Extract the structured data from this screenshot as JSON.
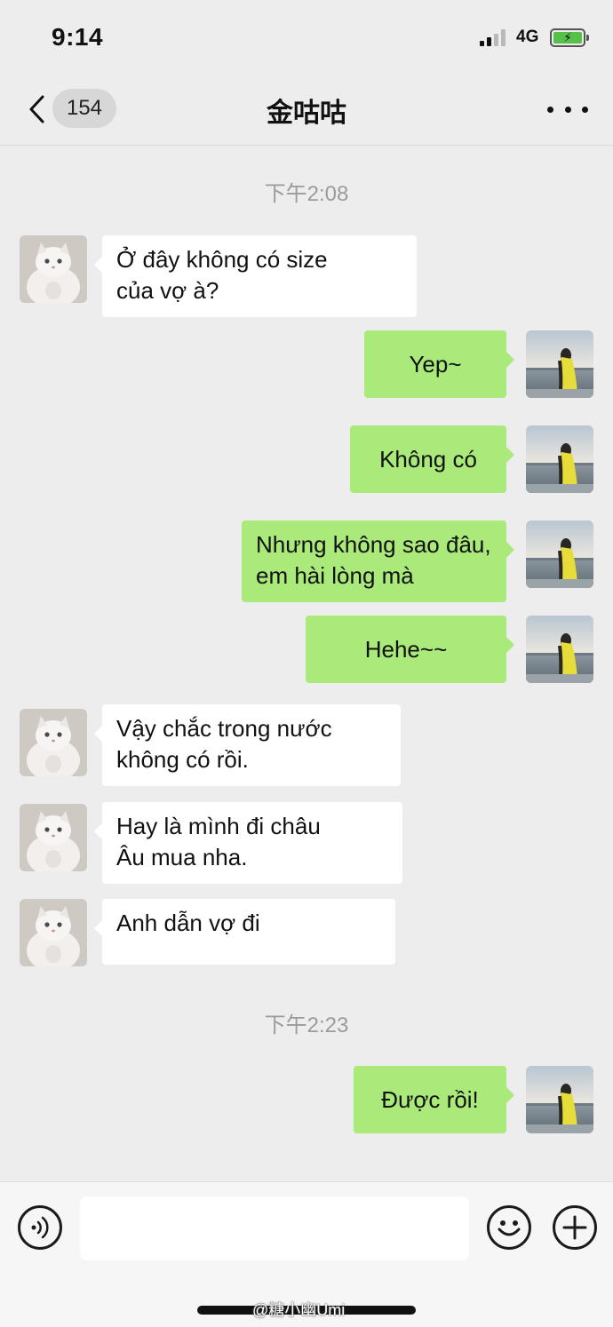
{
  "status_bar": {
    "time": "9:14",
    "network": "4G",
    "battery_charging": true
  },
  "nav": {
    "unread_count": "154",
    "title": "金咕咕"
  },
  "messages": [
    {
      "type": "time",
      "text": "下午2:08"
    },
    {
      "type": "in",
      "text": "Ở đây không có size\ncủa vợ à?",
      "avatar": "cat-avatar"
    },
    {
      "type": "out",
      "text": "Yep~",
      "avatar": "girl-avatar"
    },
    {
      "type": "out",
      "text": "Không có",
      "avatar": "girl-avatar"
    },
    {
      "type": "out",
      "text": "Nhưng không sao đâu,\nem hài lòng mà",
      "avatar": "girl-avatar"
    },
    {
      "type": "out",
      "text": "Hehe~~",
      "avatar": "girl-avatar"
    },
    {
      "type": "in",
      "text": "Vậy chắc trong nước\nkhông có rồi.",
      "avatar": "cat-avatar"
    },
    {
      "type": "in",
      "text": "Hay là mình đi châu\nÂu mua nha.",
      "avatar": "cat-avatar"
    },
    {
      "type": "in",
      "text": "Anh dẫn vợ đi",
      "avatar": "cat-avatar"
    },
    {
      "type": "time",
      "text": "下午2:23"
    },
    {
      "type": "out",
      "text": "Được rồi!",
      "avatar": "girl-avatar"
    }
  ],
  "input_bar": {
    "icons": [
      "voice-icon",
      "emoji-icon",
      "plus-icon"
    ],
    "placeholder": ""
  },
  "watermark": "@糖小幽Umi",
  "colors": {
    "background": "#ededed",
    "outgoing_bubble": "#a9ea7a",
    "incoming_bubble": "#ffffff",
    "timestamp": "#9b9b9b"
  }
}
